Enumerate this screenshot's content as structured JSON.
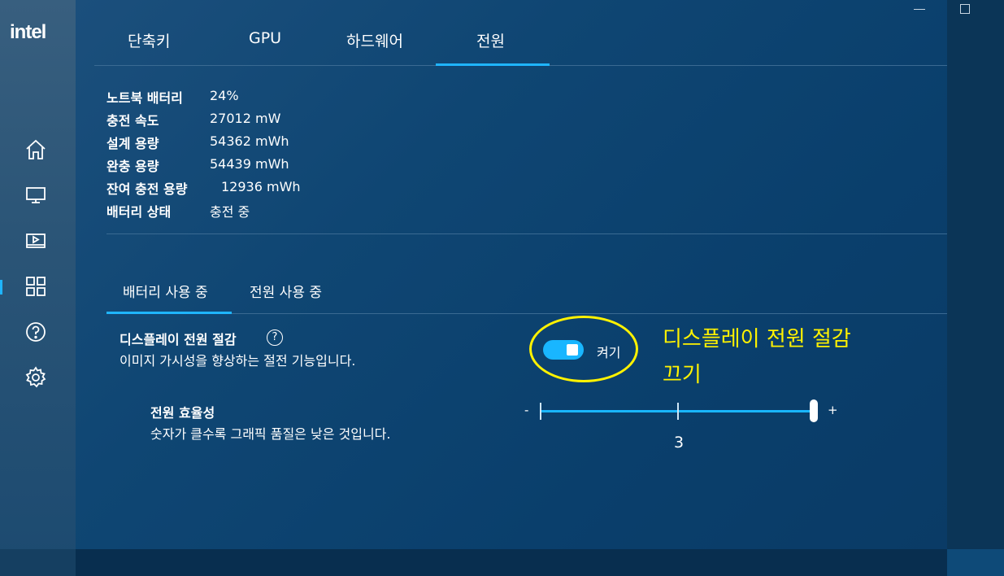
{
  "app": {
    "logo": "intel"
  },
  "sidebar": {
    "items": [
      {
        "name": "home",
        "icon": "home-icon"
      },
      {
        "name": "display",
        "icon": "monitor-icon"
      },
      {
        "name": "video",
        "icon": "video-icon"
      },
      {
        "name": "system",
        "icon": "grid-icon",
        "active": true
      },
      {
        "name": "help",
        "icon": "help-icon"
      },
      {
        "name": "settings",
        "icon": "gear-icon"
      }
    ]
  },
  "tabs": [
    {
      "label": "단축키"
    },
    {
      "label": "GPU"
    },
    {
      "label": "하드웨어"
    },
    {
      "label": "전원",
      "active": true
    }
  ],
  "battery_info": [
    {
      "label": "노트북 배터리",
      "value": "24%"
    },
    {
      "label": "충전 속도",
      "value": "27012 mW"
    },
    {
      "label": "설계 용량",
      "value": "54362 mWh"
    },
    {
      "label": "완충 용량",
      "value": "54439 mWh"
    },
    {
      "label": "잔여 충전 용량",
      "value": "12936 mWh"
    },
    {
      "label": "배터리 상태",
      "value": "충전 중"
    }
  ],
  "sub_tabs": [
    {
      "label": "배터리 사용 중",
      "active": true
    },
    {
      "label": "전원 사용 중"
    }
  ],
  "display_power_saving": {
    "title": "디스플레이 전원 절감",
    "help": "?",
    "description": "이미지 가시성을 향상하는 절전 기능입니다.",
    "toggle_label": "켜기",
    "toggle_on": true
  },
  "power_efficiency": {
    "title": "전원 효율성",
    "description": "숫자가 클수록 그래픽 품질은 낮은 것입니다.",
    "min_label": "-",
    "max_label": "+",
    "value": "3",
    "levels": 3
  },
  "annotation": {
    "line1": "디스플레이 전원 절감",
    "line2": "끄기",
    "color": "#fff200"
  },
  "colors": {
    "accent": "#1fb5ff",
    "background": "#0d3f66"
  }
}
